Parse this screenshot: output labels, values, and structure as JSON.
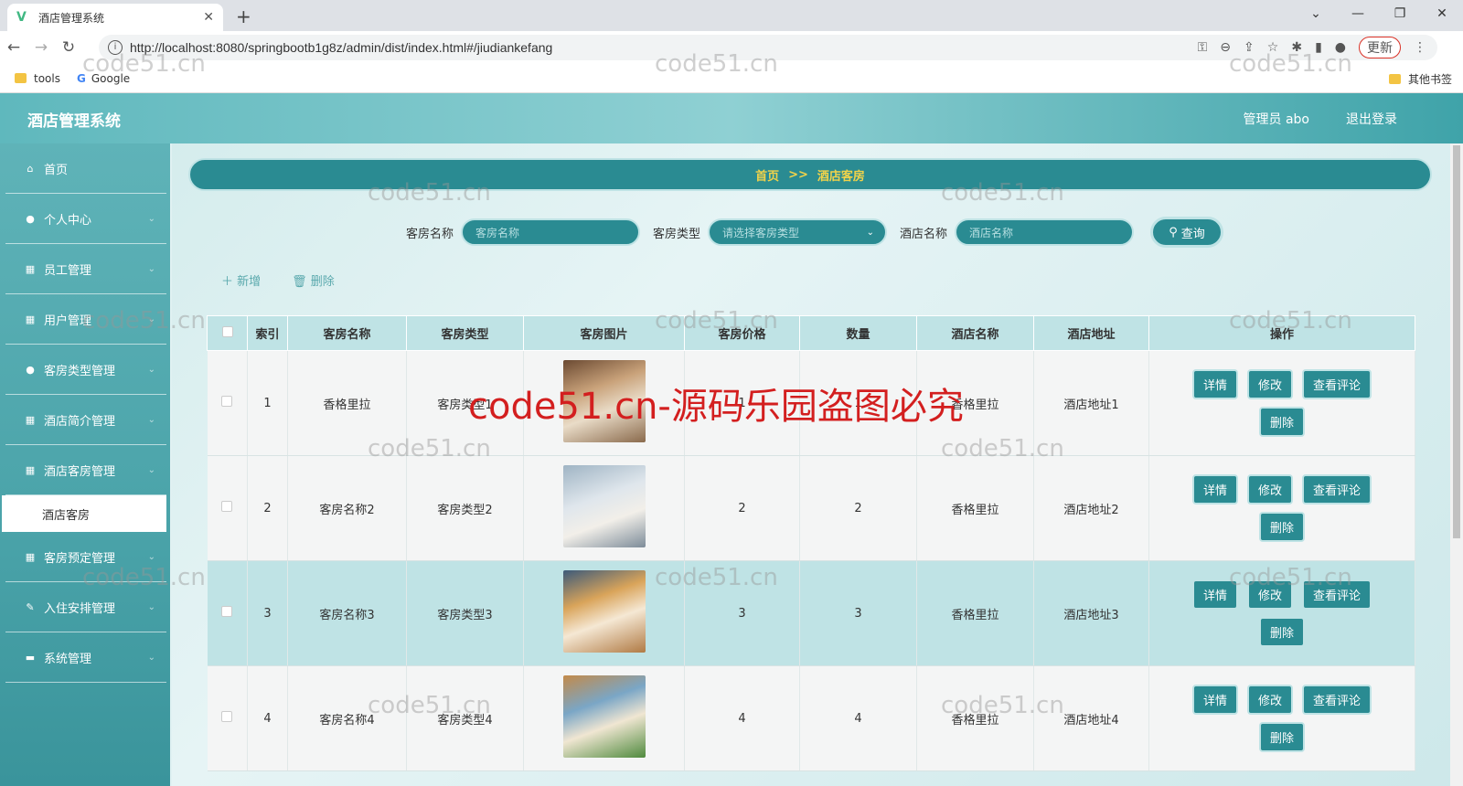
{
  "browser": {
    "tab_title": "酒店管理系统",
    "url": "http://localhost:8080/springbootb1g8z/admin/dist/index.html#/jiudiankefang",
    "update_label": "更新",
    "bookmarks": [
      "tools",
      "Google"
    ],
    "other_bookmarks": "其他书签"
  },
  "header": {
    "title": "酒店管理系统",
    "user": "管理员 abo",
    "logout": "退出登录"
  },
  "sidebar": {
    "items": [
      {
        "label": "首页",
        "icon": "home-icon"
      },
      {
        "label": "个人中心",
        "icon": "user-icon"
      },
      {
        "label": "员工管理",
        "icon": "grid-icon"
      },
      {
        "label": "用户管理",
        "icon": "grid-icon"
      },
      {
        "label": "客房类型管理",
        "icon": "user-icon"
      },
      {
        "label": "酒店简介管理",
        "icon": "grid-icon"
      },
      {
        "label": "酒店客房管理",
        "icon": "grid-icon"
      },
      {
        "label": "客房预定管理",
        "icon": "grid-icon"
      },
      {
        "label": "入住安排管理",
        "icon": "edit-icon"
      },
      {
        "label": "系统管理",
        "icon": "case-icon"
      }
    ],
    "active_sub": "酒店客房"
  },
  "breadcrumb": {
    "home": "首页",
    "sep": ">>",
    "current": "酒店客房"
  },
  "search": {
    "room_name_label": "客房名称",
    "room_name_placeholder": "客房名称",
    "room_type_label": "客房类型",
    "room_type_placeholder": "请选择客房类型",
    "hotel_name_label": "酒店名称",
    "hotel_name_placeholder": "酒店名称",
    "query_label": "查询"
  },
  "toolbar": {
    "add": "新增",
    "delete": "删除"
  },
  "table": {
    "headers": [
      "索引",
      "客房名称",
      "客房类型",
      "客房图片",
      "客房价格",
      "数量",
      "酒店名称",
      "酒店地址",
      "操作"
    ],
    "rows": [
      {
        "index": "1",
        "name": "香格里拉",
        "type": "客房类型1",
        "price": "1",
        "qty": "1",
        "hotel": "香格里拉",
        "address": "酒店地址1"
      },
      {
        "index": "2",
        "name": "客房名称2",
        "type": "客房类型2",
        "price": "2",
        "qty": "2",
        "hotel": "香格里拉",
        "address": "酒店地址2"
      },
      {
        "index": "3",
        "name": "客房名称3",
        "type": "客房类型3",
        "price": "3",
        "qty": "3",
        "hotel": "香格里拉",
        "address": "酒店地址3"
      },
      {
        "index": "4",
        "name": "客房名称4",
        "type": "客房类型4",
        "price": "4",
        "qty": "4",
        "hotel": "香格里拉",
        "address": "酒店地址4"
      }
    ],
    "ops": [
      "详情",
      "修改",
      "查看评论",
      "删除"
    ]
  },
  "watermark": "code51.cn",
  "big_watermark": "code51.cn-源码乐园盗图必究"
}
